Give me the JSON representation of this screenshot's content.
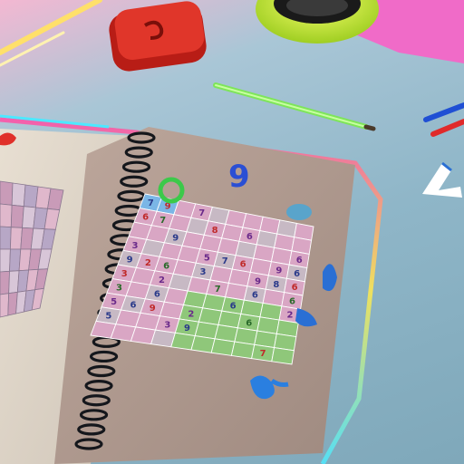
{
  "scene": {
    "kind": "photo-illustration",
    "objects": [
      "open-spiral-notebook",
      "number-grid-puzzle",
      "left-page-grid",
      "red-eraser",
      "yellow-green-toy",
      "green-pencil",
      "red-blue-pencils",
      "pink-paper-corner"
    ]
  },
  "left_grid": {
    "rows": 6,
    "cols": 5
  },
  "puzzle": {
    "rows": 10,
    "cols": 10,
    "digits": [
      [
        "7",
        "9",
        "",
        "7",
        "",
        "",
        "",
        "",
        "",
        ""
      ],
      [
        "6",
        "7",
        "",
        "",
        "8",
        "",
        "6",
        "",
        "",
        ""
      ],
      [
        "",
        "",
        "9",
        "",
        "",
        "",
        "",
        "",
        "",
        "6"
      ],
      [
        "3",
        "",
        "",
        "",
        "5",
        "7",
        "6",
        "",
        "9",
        "6"
      ],
      [
        "9",
        "2",
        "6",
        "",
        "3",
        "",
        "",
        "9",
        "8",
        "6"
      ],
      [
        "3",
        "",
        "2",
        "",
        "",
        "7",
        "",
        "6",
        "",
        "6"
      ],
      [
        "3",
        "",
        "6",
        "",
        "",
        "",
        "6",
        "",
        "",
        "2"
      ],
      [
        "5",
        "6",
        "9",
        "",
        "2",
        "",
        "",
        "6",
        "",
        ""
      ],
      [
        "5",
        "",
        "",
        "3",
        "9",
        "",
        "",
        "",
        "",
        ""
      ],
      [
        "",
        "",
        "",
        "",
        "",
        "",
        "",
        "",
        "7",
        ""
      ]
    ],
    "highlight_colors": {
      "pink": "#d9a6c4",
      "green": "#8fc77a",
      "blue": "#7ab6e6",
      "grey": "#c7b9c4"
    }
  },
  "decorations": {
    "big_digit": "9",
    "colors": {
      "page": "#b19a90",
      "binder": "#15171c",
      "eraser": "#d42a20",
      "pencil": "#7ee55a",
      "accent_blue": "#2a6fd4"
    }
  }
}
